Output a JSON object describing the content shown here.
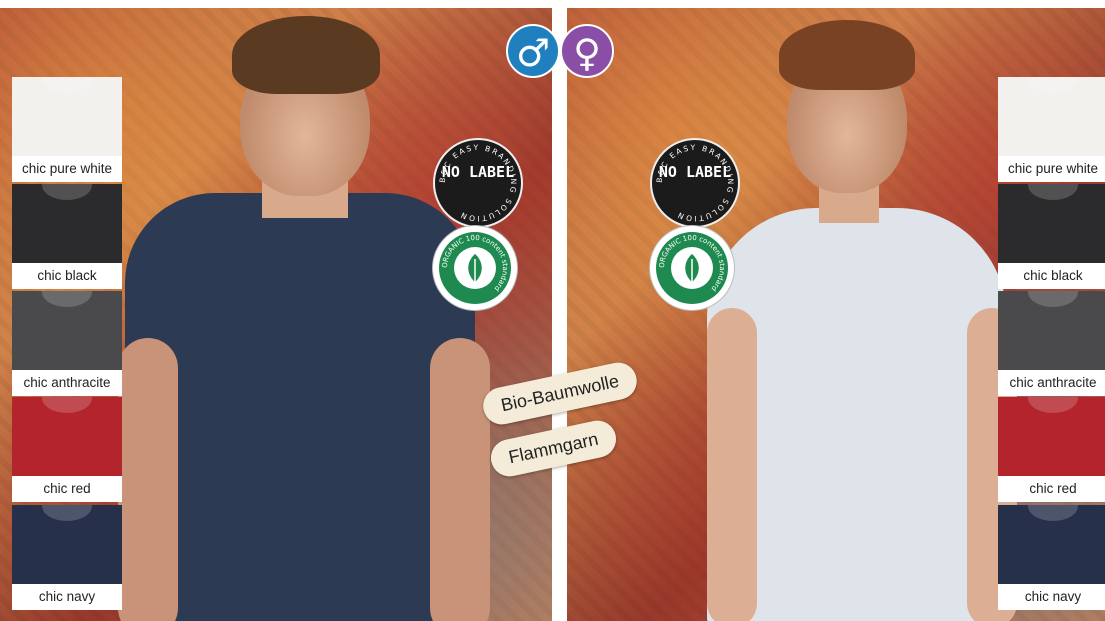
{
  "gender": {
    "male_symbol": "♂",
    "female_symbol": "♀",
    "male_color": "#1f7fbf",
    "female_color": "#8b4ea6"
  },
  "badges": {
    "no_label_main": "NO LABEL",
    "no_label_ring": "B&C EASY BRANDING SOLUTION",
    "organic_ring": "ORGANIC 100 content standard"
  },
  "tags": {
    "material": "Bio-Baumwolle",
    "yarn": "Flammgarn"
  },
  "variants": [
    {
      "label": "chic pure white",
      "color": "#f2f1ee"
    },
    {
      "label": "chic black",
      "color": "#2b2b2d"
    },
    {
      "label": "chic anthracite",
      "color": "#4a4a4c"
    },
    {
      "label": "chic red",
      "color": "#b3242c"
    },
    {
      "label": "chic navy",
      "color": "#26304a"
    }
  ],
  "shirt_colors": {
    "men": "#2c3a54",
    "women": "#dfe3ea"
  }
}
